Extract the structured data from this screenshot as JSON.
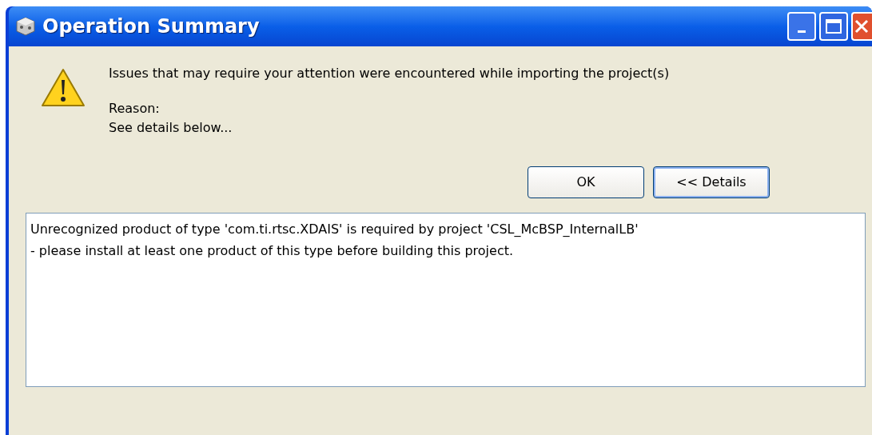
{
  "window": {
    "title": "Operation Summary"
  },
  "message": {
    "text": "Issues that may require your attention were encountered while importing the project(s)",
    "reason_label": "Reason:",
    "reason": "See details below..."
  },
  "buttons": [
    {
      "label": "OK",
      "default": false
    },
    {
      "label": "<< Details",
      "default": true
    }
  ],
  "details": {
    "lines": [
      "Unrecognized product of type 'com.ti.rtsc.XDAIS' is required by project 'CSL_McBSP_InternalLB'",
      "- please install at least one product of this type before building this project."
    ]
  }
}
